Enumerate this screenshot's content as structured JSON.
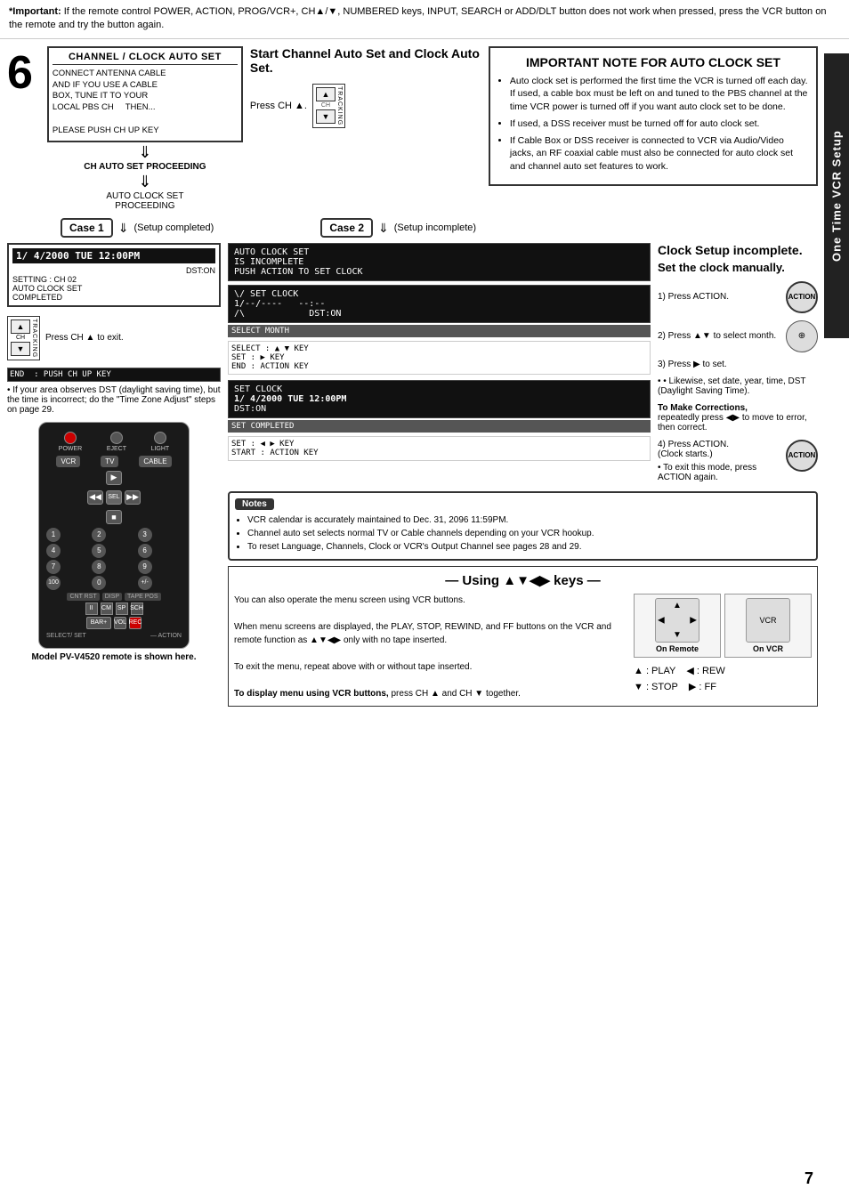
{
  "page": {
    "number": "7",
    "warning": {
      "label": "*Important:",
      "text": " If the remote control POWER, ACTION, PROG/VCR+, CH▲/▼, NUMBERED keys, INPUT, SEARCH or ADD/DLT button does not work when pressed, press the VCR button on the remote and try the button again."
    },
    "side_tab": "One Time VCR Setup"
  },
  "step6": {
    "number": "6",
    "left_box_title": "CHANNEL / CLOCK AUTO SET",
    "left_box_lines": [
      "CONNECT ANTENNA CABLE",
      "AND IF YOU USE A CABLE",
      "BOX, TUNE IT TO YOUR",
      "LOCAL PBS CH    THEN...",
      "",
      "PLEASE PUSH CH UP KEY"
    ],
    "ch_auto_set": "CH AUTO SET PROCEEDING",
    "auto_clock_set": "AUTO CLOCK SET",
    "proceeding": "PROCEEDING",
    "mid_title": "Start Channel Auto Set and Clock Auto Set.",
    "press_ch_up": "Press CH ▲.",
    "important_note_title": "IMPORTANT NOTE FOR AUTO CLOCK SET",
    "important_note_bullets": [
      "Auto clock set is performed the first time the VCR is turned off each day. If used, a cable box must be left on and tuned to the PBS channel at the time VCR power is turned off if you want auto clock set to be done.",
      "If used, a DSS receiver must be turned off for auto clock set.",
      "If Cable Box or DSS receiver is connected to VCR via Audio/Video jacks, an RF coaxial cable must also be connected for auto clock set and channel auto set features to work."
    ],
    "case1_label": "Case 1",
    "case1_text": "(Setup completed)",
    "case2_label": "Case 2",
    "case2_text": "(Setup incomplete)",
    "clock1_display": "1/ 4/2000 TUE 12:00PM",
    "clock1_dst": "DST:ON",
    "clock1_setting": "SETTING : CH 02",
    "clock1_auto": "AUTO CLOCK SET",
    "clock1_completed": "COMPLETED",
    "clock1_end": "END  : PUSH CH UP KEY",
    "press_ch_exit": "Press CH ▲ to exit.",
    "dst_note": "• If your area observes DST (daylight saving time), but the time is incorrect; do the \"Time Zone Adjust\" steps on page 29.",
    "clock_setup_incomplete_title": "Clock Setup incomplete.",
    "clock_setup_set_manually": "Set the clock manually.",
    "step1_press_action": "1) Press ACTION.",
    "step2_press": "2) Press ▲▼ to select month.",
    "step3_press": "3) Press ▶ to set.",
    "likewise_note": "• Likewise, set date, year, time, DST (Daylight Saving Time).",
    "to_make_corrections": "To Make Corrections,",
    "corrections_detail": "repeatedly press ◀▶ to move to error, then correct.",
    "step4_press": "4) Press ACTION.",
    "clock_starts": "(Clock starts.)",
    "exit_mode": "• To exit this mode, press ACTION again.",
    "auto_clock_incomplete": "AUTO CLOCK SET",
    "is_incomplete": "IS INCOMPLETE",
    "push_action_set": "PUSH ACTION TO SET CLOCK",
    "set_clock_screen1_line1": "\\/ SET CLOCK",
    "set_clock_screen1_line2": "1/--/----     --:--",
    "set_clock_screen1_line3": "/\\              DST:ON",
    "select_month_label": "SELECT MONTH",
    "select_key": "SELECT : ▲ ▼ KEY",
    "set_key": "SET       : ▶ KEY",
    "end_key": "END       : ACTION KEY",
    "set_clock_screen2_line1": "SET CLOCK",
    "set_clock_screen2_line2": "1/ 4/2000 TUE 12:00PM",
    "set_clock_screen2_dst": "DST:ON",
    "set_completed_label": "SET COMPLETED",
    "set_line1": "SET       : ◀ ▶ KEY",
    "start_line": "START  : ACTION KEY",
    "notes_title": "Notes",
    "notes_bullets": [
      "VCR calendar is accurately maintained to Dec. 31, 2096 11:59PM.",
      "Channel auto set selects normal TV or Cable channels depending on your VCR hookup.",
      "To reset Language, Channels, Clock or VCR's Output Channel see pages 28 and 29."
    ],
    "using_keys_title": "— Using ▲▼◀▶ keys —",
    "using_keys_para1": "You can also operate the menu screen using VCR buttons.",
    "using_keys_para2": "When menu screens are displayed, the PLAY, STOP, REWIND, and FF buttons on the VCR and remote function as ▲▼◀▶ only with no tape inserted.",
    "using_keys_para3": "To exit the menu, repeat above with or without tape inserted.",
    "using_keys_para4_bold": "To display menu using VCR buttons,",
    "using_keys_para4": " press CH ▲ and CH ▼ together.",
    "on_remote_label": "On Remote",
    "on_vcr_label": "On VCR",
    "key_a_play": "▲ : PLAY",
    "key_b_rew": "◀ : REW",
    "key_c_stop": "▼ : STOP",
    "key_d_ff": "▶ : FF",
    "model_text": "Model PV-V4520 remote is shown here.",
    "select_set_label": "SELECT/ SET",
    "action_label": "— ACTION",
    "ch_up_label": "CH ▲",
    "play_label": "▲:PLAY",
    "stop_label": "▼:STOP",
    "rew_label": "◀:REW",
    "ff_label": "▶:FF"
  }
}
